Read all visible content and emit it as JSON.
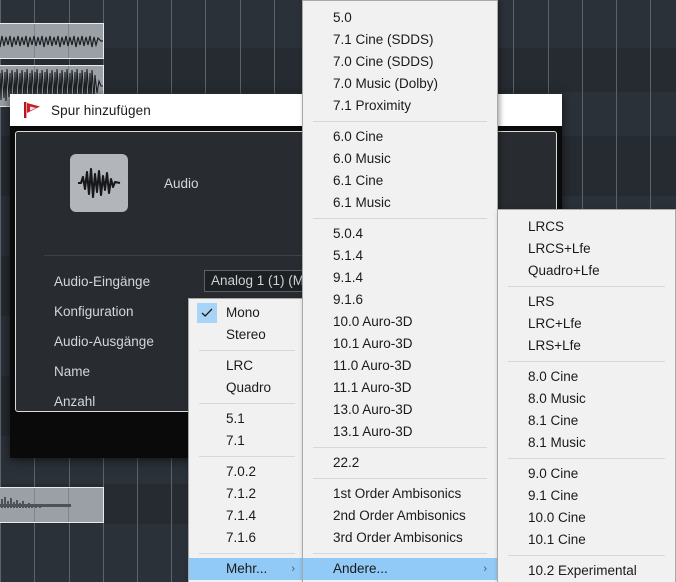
{
  "app": {
    "background_name": "daw-timeline"
  },
  "dialog": {
    "title": "Spur hinzufügen",
    "title_icon": "nuendo-flag-icon",
    "track_type": {
      "label": "Audio",
      "icon": "audio-waveform-icon"
    },
    "fields": [
      {
        "label": "Audio-Eingänge",
        "value": "Analog 1 (1) (Mono)",
        "name": "audio-inputs"
      },
      {
        "label": "Konfiguration",
        "value": "Mono",
        "name": "configuration"
      },
      {
        "label": "Audio-Ausgänge",
        "value": "",
        "name": "audio-outputs"
      },
      {
        "label": "Name",
        "value": "",
        "name": "name"
      },
      {
        "label": "Anzahl",
        "value": "",
        "name": "count"
      }
    ]
  },
  "menus": {
    "configuration": {
      "name": "configuration-menu",
      "items": [
        {
          "label": "Mono",
          "checked": true
        },
        {
          "label": "Stereo"
        },
        {
          "separator": true
        },
        {
          "label": "LRC"
        },
        {
          "label": "Quadro"
        },
        {
          "separator": true
        },
        {
          "label": "5.1"
        },
        {
          "label": "7.1"
        },
        {
          "separator": true
        },
        {
          "label": "7.0.2"
        },
        {
          "label": "7.1.2"
        },
        {
          "label": "7.1.4"
        },
        {
          "label": "7.1.6"
        },
        {
          "separator": true
        },
        {
          "label": "Mehr...",
          "submenu": true,
          "highlighted": true
        }
      ]
    },
    "more": {
      "name": "more-submenu",
      "items": [
        {
          "label": "5.0"
        },
        {
          "label": "7.1 Cine (SDDS)"
        },
        {
          "label": "7.0 Cine (SDDS)"
        },
        {
          "label": "7.0 Music (Dolby)"
        },
        {
          "label": "7.1 Proximity"
        },
        {
          "separator": true
        },
        {
          "label": "6.0 Cine"
        },
        {
          "label": "6.0 Music"
        },
        {
          "label": "6.1 Cine"
        },
        {
          "label": "6.1 Music"
        },
        {
          "separator": true
        },
        {
          "label": "5.0.4"
        },
        {
          "label": "5.1.4"
        },
        {
          "label": "9.1.4"
        },
        {
          "label": "9.1.6"
        },
        {
          "label": "10.0 Auro-3D"
        },
        {
          "label": "10.1 Auro-3D"
        },
        {
          "label": "11.0 Auro-3D"
        },
        {
          "label": "11.1 Auro-3D"
        },
        {
          "label": "13.0 Auro-3D"
        },
        {
          "label": "13.1 Auro-3D"
        },
        {
          "separator": true
        },
        {
          "label": "22.2"
        },
        {
          "separator": true
        },
        {
          "label": "1st Order Ambisonics"
        },
        {
          "label": "2nd Order Ambisonics"
        },
        {
          "label": "3rd Order Ambisonics"
        },
        {
          "separator": true
        },
        {
          "label": "Andere...",
          "submenu": true,
          "highlighted": true
        }
      ]
    },
    "other": {
      "name": "other-submenu",
      "items": [
        {
          "label": "LRCS"
        },
        {
          "label": "LRCS+Lfe"
        },
        {
          "label": "Quadro+Lfe"
        },
        {
          "separator": true
        },
        {
          "label": "LRS"
        },
        {
          "label": "LRC+Lfe"
        },
        {
          "label": "LRS+Lfe"
        },
        {
          "separator": true
        },
        {
          "label": "8.0 Cine"
        },
        {
          "label": "8.0 Music"
        },
        {
          "label": "8.1 Cine"
        },
        {
          "label": "8.1 Music"
        },
        {
          "separator": true
        },
        {
          "label": "9.0 Cine"
        },
        {
          "label": "9.1 Cine"
        },
        {
          "label": "10.0 Cine"
        },
        {
          "label": "10.1 Cine"
        },
        {
          "separator": true
        },
        {
          "label": "10.2 Experimental"
        }
      ]
    }
  },
  "colors": {
    "menu_bg": "#f1f1f1",
    "menu_highlight": "#91c9f7",
    "dialog_bg": "#282c30",
    "focus_ring": "#1e7fd4",
    "timeline_bg": "#2b3138",
    "clip_fill": "#9aa0a6"
  }
}
